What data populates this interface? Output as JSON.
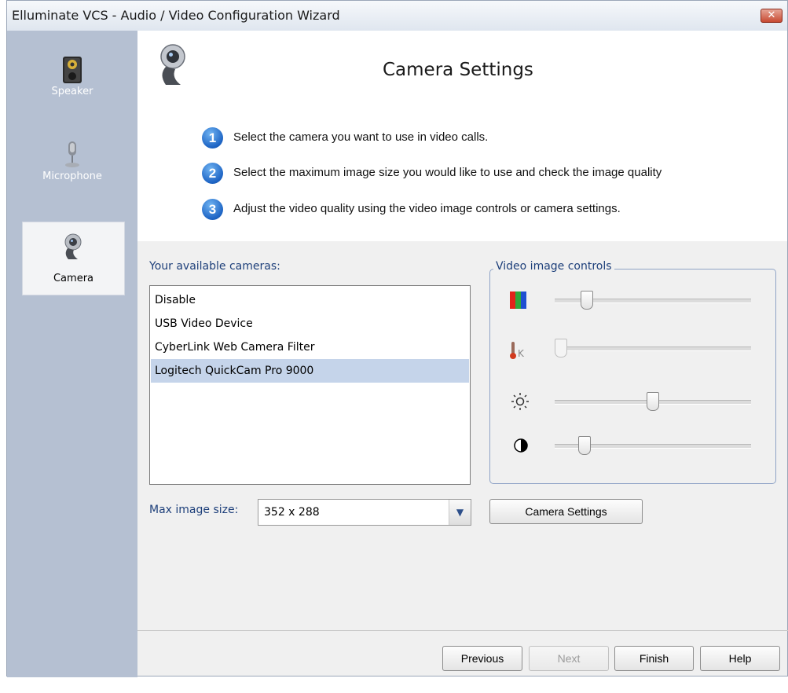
{
  "window": {
    "title": "Elluminate VCS - Audio / Video Configuration Wizard",
    "close_label": "✕"
  },
  "sidebar": {
    "items": [
      {
        "label": "Speaker",
        "icon": "speaker-icon",
        "active": false
      },
      {
        "label": "Microphone",
        "icon": "microphone-icon",
        "active": false
      },
      {
        "label": "Camera",
        "icon": "webcam-icon",
        "active": true
      }
    ]
  },
  "header": {
    "title": "Camera Settings",
    "icon": "webcam-icon",
    "steps": [
      {
        "num": "1",
        "text": "Select the camera you want to use in video calls."
      },
      {
        "num": "2",
        "text": "Select the maximum image size you would like to use and check the image quality"
      },
      {
        "num": "3",
        "text": "Adjust the video quality using the video image controls or camera settings."
      }
    ]
  },
  "cameras": {
    "label": "Your available cameras:",
    "items": [
      "Disable",
      "USB Video Device",
      "CyberLink Web Camera Filter",
      "Logitech QuickCam Pro 9000"
    ],
    "selected": "Logitech QuickCam Pro 9000"
  },
  "video_controls": {
    "legend": "Video image controls",
    "controls": [
      {
        "icon": "color-bars-icon",
        "value_fraction": 0.14,
        "enabled": true
      },
      {
        "icon": "color-temperature-icon",
        "value_fraction": 0.0,
        "enabled": false
      },
      {
        "icon": "brightness-icon",
        "value_fraction": 0.5,
        "enabled": true
      },
      {
        "icon": "contrast-icon",
        "value_fraction": 0.13,
        "enabled": true
      }
    ]
  },
  "max_image_size": {
    "label": "Max image size:",
    "value": "352 x 288"
  },
  "buttons": {
    "camera_settings": "Camera Settings",
    "previous": "Previous",
    "next": "Next",
    "finish": "Finish",
    "help": "Help"
  },
  "colors": {
    "sidebar": "#b5c0d2",
    "selection": "#c5d4ea",
    "label_blue": "#1d3f7a",
    "step_badge": "#1d64c4"
  }
}
